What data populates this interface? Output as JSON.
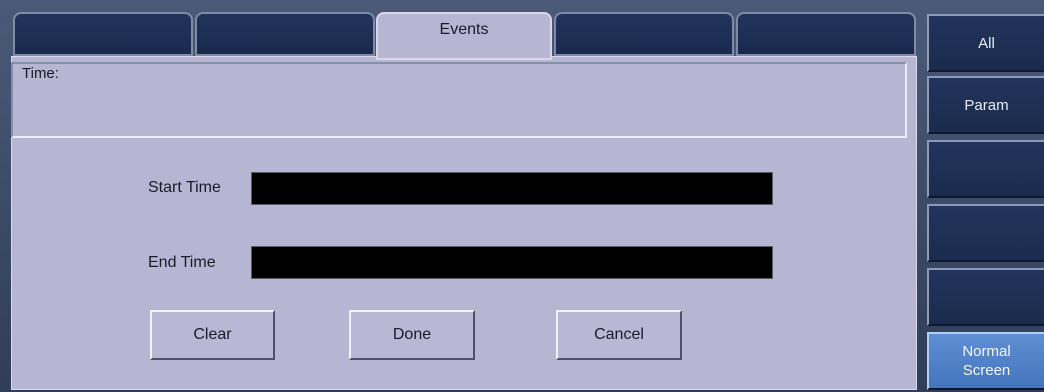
{
  "tabs": [
    {
      "label": ""
    },
    {
      "label": ""
    },
    {
      "label": "Events"
    },
    {
      "label": ""
    },
    {
      "label": ""
    }
  ],
  "time_box": {
    "label": "Time:"
  },
  "form": {
    "start_label": "Start Time",
    "start_value": "",
    "end_label": "End Time",
    "end_value": ""
  },
  "buttons": {
    "clear": "Clear",
    "done": "Done",
    "cancel": "Cancel"
  },
  "sidebar": {
    "items": [
      {
        "label": "All"
      },
      {
        "label": "Param"
      },
      {
        "label": ""
      },
      {
        "label": ""
      },
      {
        "label": ""
      },
      {
        "label": "Normal\nScreen"
      }
    ]
  }
}
